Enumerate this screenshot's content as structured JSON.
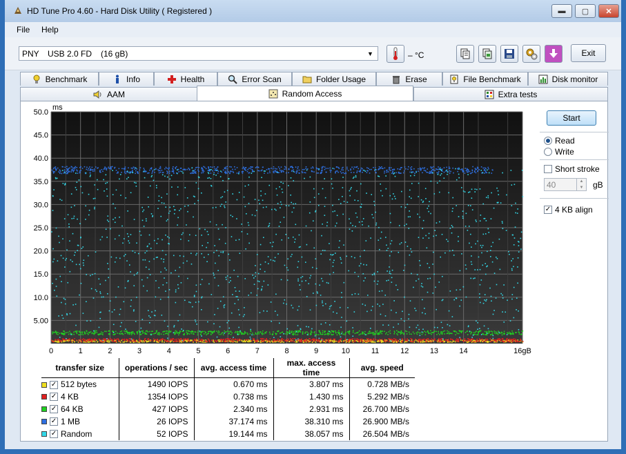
{
  "window": {
    "title": "HD Tune Pro 4.60 - Hard Disk Utility ( Registered )"
  },
  "menu": {
    "file": "File",
    "help": "Help"
  },
  "toolbar": {
    "drive": {
      "name": "PNY",
      "model": "USB 2.0 FD",
      "size": "(16 gB)"
    },
    "temperature": "– °C",
    "exit_label": "Exit"
  },
  "tabs_row1": [
    "Benchmark",
    "Info",
    "Health",
    "Error Scan",
    "Folder Usage",
    "Erase",
    "File Benchmark",
    "Disk monitor"
  ],
  "tabs_row2": [
    "AAM",
    "Random Access",
    "Extra tests"
  ],
  "active_tab": "Random Access",
  "side": {
    "start_label": "Start",
    "read_label": "Read",
    "write_label": "Write",
    "mode_selected": "Read",
    "short_stroke_label": "Short stroke",
    "short_stroke_checked": false,
    "short_stroke_value": "40",
    "short_stroke_unit": "gB",
    "align_label": "4 KB align",
    "align_checked": true
  },
  "chart_data": {
    "type": "scatter",
    "ylabel": "ms",
    "y_ticks": [
      "5.00",
      "10.0",
      "15.0",
      "20.0",
      "25.0",
      "30.0",
      "35.0",
      "40.0",
      "45.0",
      "50.0"
    ],
    "ylim": [
      0,
      50
    ],
    "x_ticks": [
      "0",
      "1",
      "2",
      "3",
      "4",
      "5",
      "6",
      "7",
      "8",
      "9",
      "10",
      "11",
      "12",
      "13",
      "14",
      "16gB"
    ],
    "xlim": [
      0,
      16
    ],
    "background": "#0d0d0d",
    "grid": true,
    "series": [
      {
        "name": "512 bytes",
        "color": "#f0e020",
        "band_ms": [
          0.4,
          0.9
        ],
        "x_range": [
          0,
          16
        ]
      },
      {
        "name": "4 KB",
        "color": "#e02020",
        "band_ms": [
          0.5,
          1.2
        ],
        "x_range": [
          0,
          16
        ]
      },
      {
        "name": "64 KB",
        "color": "#20d020",
        "band_ms": [
          2.0,
          2.9
        ],
        "x_range": [
          0,
          16
        ]
      },
      {
        "name": "1 MB",
        "color": "#2e6fe0",
        "band_ms": [
          36.8,
          38.3
        ],
        "x_range": [
          0,
          15
        ]
      },
      {
        "name": "Random",
        "color": "#33d8e8",
        "band_ms": [
          0.5,
          38.0
        ],
        "x_range": [
          0,
          16
        ]
      }
    ]
  },
  "stats": {
    "headers": [
      "transfer size",
      "operations / sec",
      "avg. access time",
      "max. access time",
      "avg. speed"
    ],
    "rows": [
      {
        "label": "512 bytes",
        "color": "#f0e020",
        "ops": "1490 IOPS",
        "avg": "0.670 ms",
        "max": "3.807 ms",
        "speed": "0.728 MB/s"
      },
      {
        "label": "4 KB",
        "color": "#e02020",
        "ops": "1354 IOPS",
        "avg": "0.738 ms",
        "max": "1.430 ms",
        "speed": "5.292 MB/s"
      },
      {
        "label": "64 KB",
        "color": "#20d020",
        "ops": "427 IOPS",
        "avg": "2.340 ms",
        "max": "2.931 ms",
        "speed": "26.700 MB/s"
      },
      {
        "label": "1 MB",
        "color": "#2e6fe0",
        "ops": "26 IOPS",
        "avg": "37.174 ms",
        "max": "38.310 ms",
        "speed": "26.900 MB/s"
      },
      {
        "label": "Random",
        "color": "#33d8e8",
        "ops": "52 IOPS",
        "avg": "19.144 ms",
        "max": "38.057 ms",
        "speed": "26.504 MB/s"
      }
    ]
  }
}
